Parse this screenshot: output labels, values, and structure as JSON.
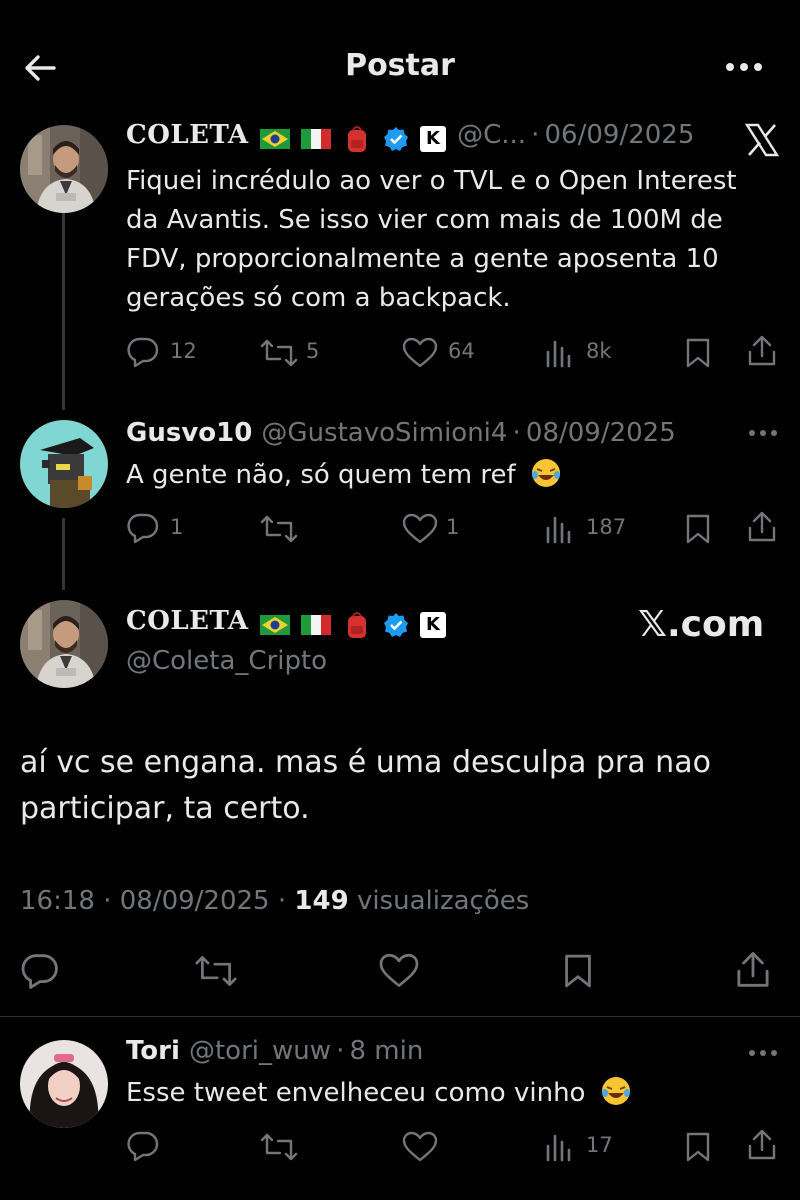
{
  "header": {
    "title": "Postar"
  },
  "thread": [
    {
      "name": "COLETA",
      "handle": "@C...",
      "sep": "·",
      "date": "06/09/2025",
      "text_lines": [
        "Fiquei incrédulo ao ver o TVL e o Open Interest",
        "da Avantis. Se isso vier com mais de 100M de",
        "FDV, proporcionalmente a gente aposenta 10",
        "gerações só com a backpack."
      ],
      "replies": "12",
      "reposts": "5",
      "likes": "64",
      "views": "8k"
    },
    {
      "name": "Gusvo10",
      "handle": "@GustavoSimioni4",
      "sep": "·",
      "date": "08/09/2025",
      "text": "A gente não, só quem tem ref",
      "replies": "1",
      "likes": "1",
      "views": "187"
    }
  ],
  "main": {
    "name": "COLETA",
    "handle": "@Coleta_Cripto",
    "watermark": "𝕏.com",
    "text_lines": [
      "aí vc se engana. mas é uma desculpa pra nao",
      "participar, ta certo."
    ],
    "time": "16:18",
    "date": "08/09/2025",
    "views_count": "149",
    "views_label": "visualizações"
  },
  "reply": {
    "name": "Tori",
    "handle": "@tori_wuw",
    "sep": "·",
    "date": "8 min",
    "text": "Esse tweet envelheceu como vinho",
    "views": "17"
  },
  "colors": {
    "background": "#000000",
    "text": "#e7e9ea",
    "muted": "#71767b",
    "verified": "#1d9bf0",
    "divider": "#2f3336"
  }
}
